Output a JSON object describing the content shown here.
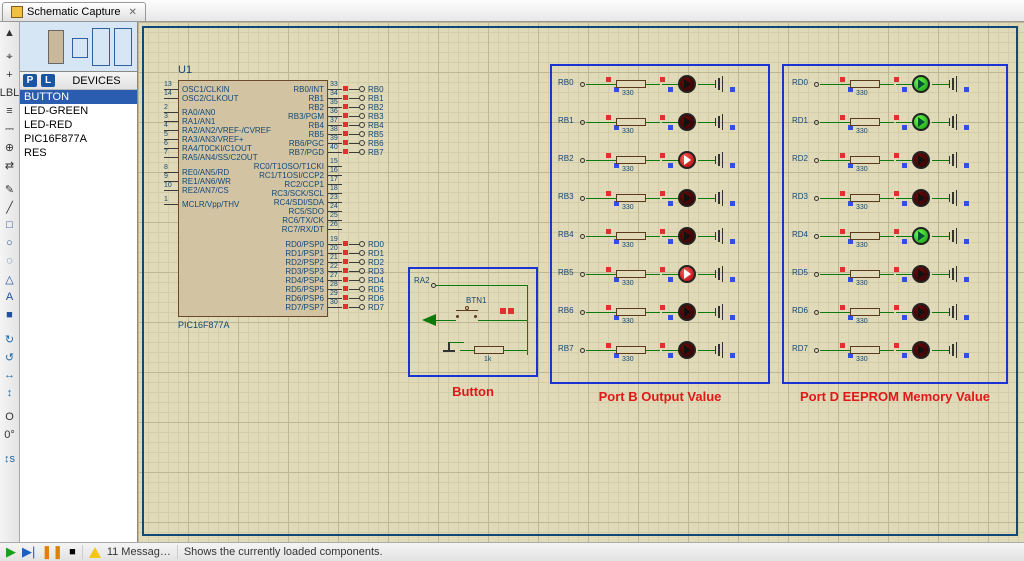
{
  "tab": {
    "title": "Schematic Capture"
  },
  "devices": {
    "header": "DEVICES",
    "items": [
      "BUTTON",
      "LED-GREEN",
      "LED-RED",
      "PIC16F877A",
      "RES"
    ],
    "selected": 0
  },
  "chip": {
    "ref": "U1",
    "part": "PIC16F877A",
    "left_pins": [
      {
        "num": "13",
        "name": "OSC1/CLKIN"
      },
      {
        "num": "14",
        "name": "OSC2/CLKOUT"
      },
      {
        "gap": true
      },
      {
        "num": "2",
        "name": "RA0/AN0"
      },
      {
        "num": "3",
        "name": "RA1/AN1"
      },
      {
        "num": "4",
        "name": "RA2/AN2/VREF-/CVREF"
      },
      {
        "num": "5",
        "name": "RA3/AN3/VREF+"
      },
      {
        "num": "6",
        "name": "RA4/T0CKI/C1OUT"
      },
      {
        "num": "7",
        "name": "RA5/AN4/SS/C2OUT"
      },
      {
        "gap": true
      },
      {
        "num": "8",
        "name": "RE0/AN5/RD"
      },
      {
        "num": "9",
        "name": "RE1/AN6/WR"
      },
      {
        "num": "10",
        "name": "RE2/AN7/CS"
      },
      {
        "gap": true
      },
      {
        "num": "1",
        "name": "MCLR/Vpp/THV"
      }
    ],
    "right_pins": [
      {
        "num": "33",
        "name": "RB0/INT",
        "net": "RB0"
      },
      {
        "num": "34",
        "name": "RB1",
        "net": "RB1"
      },
      {
        "num": "35",
        "name": "RB2",
        "net": "RB2"
      },
      {
        "num": "36",
        "name": "RB3/PGM",
        "net": "RB3"
      },
      {
        "num": "37",
        "name": "RB4",
        "net": "RB4"
      },
      {
        "num": "38",
        "name": "RB5",
        "net": "RB5"
      },
      {
        "num": "39",
        "name": "RB6/PGC",
        "net": "RB6"
      },
      {
        "num": "40",
        "name": "RB7/PGD",
        "net": "RB7"
      },
      {
        "gap": true
      },
      {
        "num": "15",
        "name": "RC0/T1OSO/T1CKI"
      },
      {
        "num": "16",
        "name": "RC1/T1OSI/CCP2"
      },
      {
        "num": "17",
        "name": "RC2/CCP1"
      },
      {
        "num": "18",
        "name": "RC3/SCK/SCL"
      },
      {
        "num": "23",
        "name": "RC4/SDI/SDA"
      },
      {
        "num": "24",
        "name": "RC5/SDO"
      },
      {
        "num": "25",
        "name": "RC6/TX/CK"
      },
      {
        "num": "26",
        "name": "RC7/RX/DT"
      },
      {
        "gap": true
      },
      {
        "num": "19",
        "name": "RD0/PSP0",
        "net": "RD0"
      },
      {
        "num": "20",
        "name": "RD1/PSP1",
        "net": "RD1"
      },
      {
        "num": "21",
        "name": "RD2/PSP2",
        "net": "RD2"
      },
      {
        "num": "22",
        "name": "RD3/PSP3",
        "net": "RD3"
      },
      {
        "num": "27",
        "name": "RD4/PSP4",
        "net": "RD4"
      },
      {
        "num": "28",
        "name": "RD5/PSP5",
        "net": "RD5"
      },
      {
        "num": "29",
        "name": "RD6/PSP6",
        "net": "RD6"
      },
      {
        "num": "30",
        "name": "RD7/PSP7",
        "net": "RD7"
      }
    ]
  },
  "button_group": {
    "title": "Button",
    "ref": "BTN1",
    "signal": "RA2",
    "res_value": "1k"
  },
  "portb": {
    "title": "Port B Output Value",
    "res_value": "330",
    "leds": [
      {
        "net": "RB0",
        "state": "dark"
      },
      {
        "net": "RB1",
        "state": "dark"
      },
      {
        "net": "RB2",
        "state": "redlit"
      },
      {
        "net": "RB3",
        "state": "dark"
      },
      {
        "net": "RB4",
        "state": "dark"
      },
      {
        "net": "RB5",
        "state": "redlit"
      },
      {
        "net": "RB6",
        "state": "dark"
      },
      {
        "net": "RB7",
        "state": "dark"
      }
    ]
  },
  "portd": {
    "title": "Port D  EEPROM Memory Value",
    "res_value": "330",
    "leds": [
      {
        "net": "RD0",
        "state": "green"
      },
      {
        "net": "RD1",
        "state": "green"
      },
      {
        "net": "RD2",
        "state": "dark"
      },
      {
        "net": "RD3",
        "state": "dark"
      },
      {
        "net": "RD4",
        "state": "green"
      },
      {
        "net": "RD5",
        "state": "dark"
      },
      {
        "net": "RD6",
        "state": "dark"
      },
      {
        "net": "RD7",
        "state": "dark"
      }
    ]
  },
  "status": {
    "messages": "11 Messag…",
    "text": "Shows the currently loaded components."
  },
  "tools": [
    "▲",
    "sep",
    "⌖",
    "+",
    "LBL",
    "≡",
    "⎓",
    "⊕",
    "⇄",
    "sep",
    "✎",
    "╱",
    "□",
    "○",
    "◌",
    "△",
    "A",
    "■",
    "sep",
    "↻",
    "↺",
    "↔",
    "↕",
    "sep",
    "O",
    "0°",
    "sep",
    "↕s"
  ]
}
